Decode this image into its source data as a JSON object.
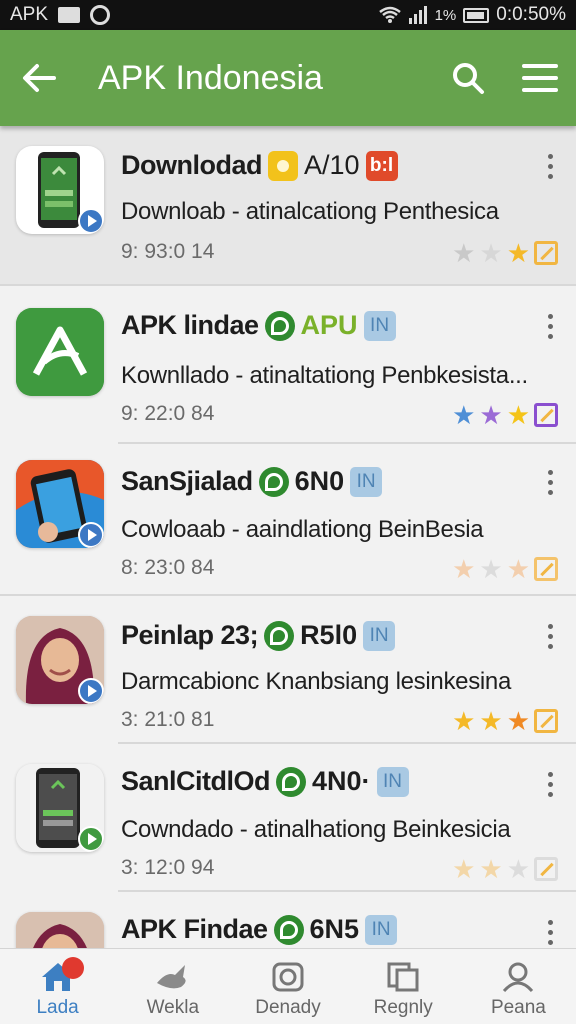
{
  "status_bar": {
    "left_text": "APK",
    "time": "0:0:50%",
    "battery_pct": "1%"
  },
  "app_bar": {
    "title": "APK Indonesia",
    "back_icon": "arrow-left-icon",
    "search_icon": "search-icon",
    "menu_icon": "hamburger-menu-icon"
  },
  "items": [
    {
      "title": "Downlodad",
      "badge_icon": "yellow-shield-icon",
      "code": "A/10",
      "tag": "b:l",
      "description": "Downloab - atinalcationg Penthesica",
      "meta": "9: 93:0 14",
      "stars": [
        "grey",
        "grey",
        "gold",
        "square"
      ]
    },
    {
      "title": "APK lindae",
      "badge_icon": "green-leaf-icon",
      "code": "APU",
      "tag": "IN",
      "description": "Kownllado - atinaltationg Penbkesista...",
      "meta": "9: 22:0 84",
      "stars": [
        "blue",
        "purple",
        "gold",
        "square-purple"
      ]
    },
    {
      "title": "SanSjialad",
      "badge_icon": "green-leaf-icon",
      "code": "6N0",
      "tag": "IN",
      "description": "Cowloaab - aaindlationg BeinBesia",
      "meta": "8: 23:0 84",
      "stars": [
        "peach",
        "grey",
        "peach",
        "square"
      ]
    },
    {
      "title": "Peinlap 23;",
      "badge_icon": "green-leaf-icon",
      "code": "R5l0",
      "tag": "IN",
      "description": "Darmcabionc Knanbsiang lesinkesina",
      "meta": "3: 21:0 81",
      "stars": [
        "gold",
        "gold",
        "orange",
        "square"
      ]
    },
    {
      "title": "SanlCitdlOd",
      "badge_icon": "green-leaf-icon",
      "code": "4N0·",
      "tag": "IN",
      "description": "Cowndado - atinalhationg Beinkesicia",
      "meta": "3: 12:0 94",
      "stars": [
        "peach",
        "peach",
        "grey",
        "square-grey"
      ]
    },
    {
      "title": "APK Findae",
      "badge_icon": "green-leaf-icon",
      "code": "6N5",
      "tag": "IN",
      "description": "",
      "meta": "",
      "stars": []
    }
  ],
  "bottom_nav": [
    {
      "label": "Lada",
      "icon": "home-icon",
      "active": true
    },
    {
      "label": "Wekla",
      "icon": "bird-icon",
      "active": false
    },
    {
      "label": "Denady",
      "icon": "camera-icon",
      "active": false
    },
    {
      "label": "Regnly",
      "icon": "cards-icon",
      "active": false
    },
    {
      "label": "Peana",
      "icon": "user-icon",
      "active": false
    }
  ],
  "colors": {
    "app_bar": "#66a34d",
    "accent": "#3d7fc2",
    "star_gold": "#f4b928"
  }
}
